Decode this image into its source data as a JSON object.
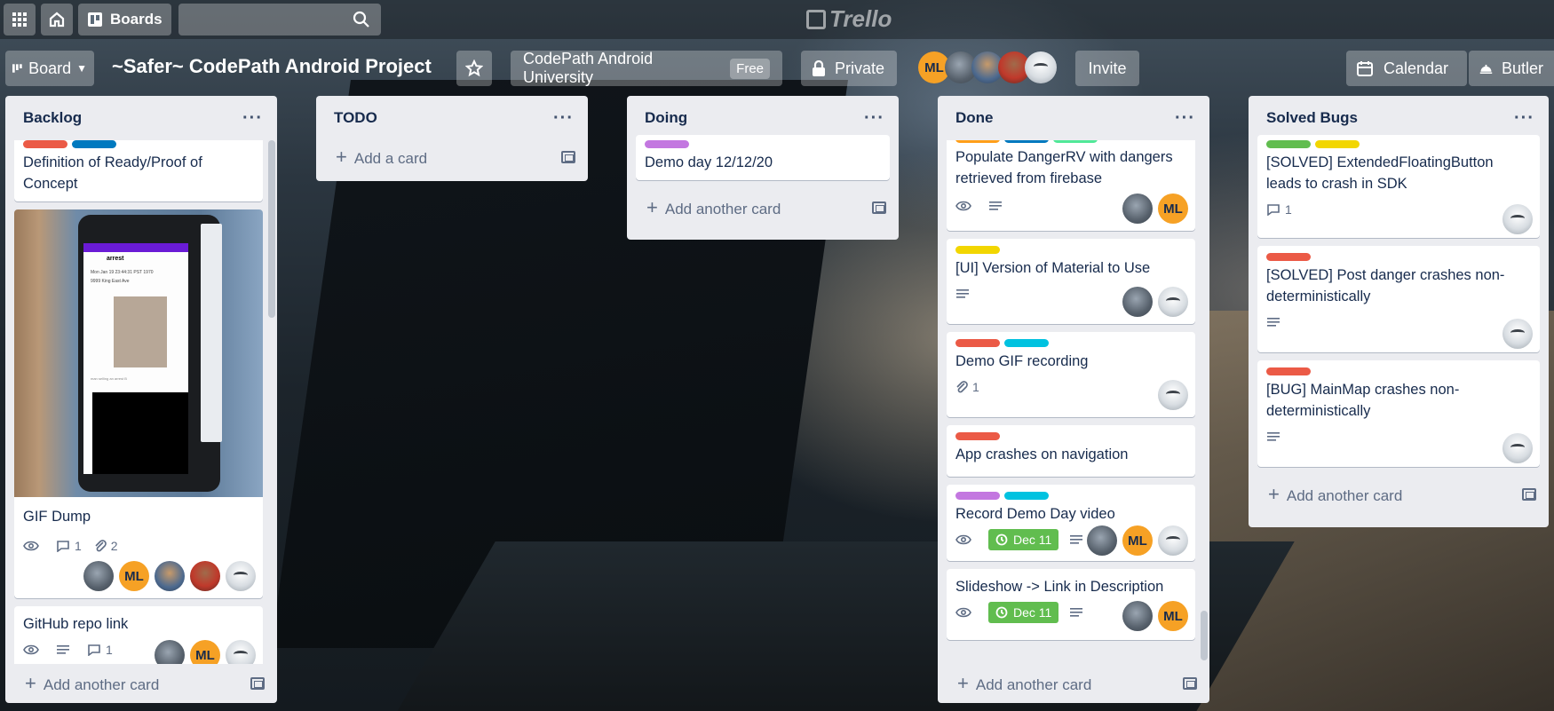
{
  "topbar": {
    "apps_icon": "grid-icon",
    "home_icon": "home-icon",
    "boards_label": "Boards",
    "search_placeholder": "",
    "logo_text": "Trello"
  },
  "board": {
    "switch_label": "Board",
    "title": "~Safer~ CodePath Android Project",
    "workspace": "CodePath Android University",
    "workspace_badge": "Free",
    "visibility": "Private",
    "invite_label": "Invite",
    "calendar_label": "Calendar",
    "butler_label": "Butler",
    "members": [
      "ML",
      "",
      "",
      "",
      ""
    ]
  },
  "lists": [
    {
      "title": "Backlog",
      "add_label": "Add another card",
      "cards": [
        {
          "title": "Definition of Ready/Proof of Concept",
          "labels": [
            "#eb5a46",
            "#0079bf"
          ]
        },
        {
          "title": "GIF Dump",
          "watch": true,
          "comments": "1",
          "attachments": "2",
          "members": [
            "p1",
            "ML",
            "p2",
            "p3",
            "bot"
          ]
        },
        {
          "title": "GitHub repo link",
          "watch": true,
          "description": true,
          "comments": "1",
          "members": [
            "p1",
            "ML",
            "bot"
          ]
        }
      ]
    },
    {
      "title": "TODO",
      "add_label": "Add a card",
      "cards": []
    },
    {
      "title": "Doing",
      "add_label": "Add another card",
      "cards": [
        {
          "title": "Demo day 12/12/20",
          "labels": [
            "#c377e0"
          ]
        }
      ]
    },
    {
      "title": "Done",
      "add_label": "Add another card",
      "cards": [
        {
          "title": "Populate DangerRV with dangers retrieved from firebase",
          "labels": [
            "#ff9f1a",
            "#0079bf",
            "#51e898"
          ]
        },
        {
          "title": "[UI] Version of Material to Use",
          "labels": [
            "#f2d600"
          ]
        },
        {
          "title": "Demo GIF recording",
          "labels": [
            "#eb5a46",
            "#00c2e0"
          ],
          "attachments": "1"
        },
        {
          "title": "App crashes on navigation",
          "labels": [
            "#eb5a46"
          ]
        },
        {
          "title": "Record Demo Day video",
          "labels": [
            "#c377e0",
            "#00c2e0"
          ],
          "due": "Dec 11"
        },
        {
          "title": "Slideshow -> Link in Description",
          "due": "Dec 11"
        }
      ]
    },
    {
      "title": "Solved Bugs",
      "add_label": "Add another card",
      "cards": [
        {
          "title": "[SOLVED] ExtendedFloatingButton leads to crash in SDK",
          "labels": [
            "#61bd4f",
            "#f2d600"
          ],
          "comments": "1"
        },
        {
          "title": "[SOLVED] Post danger crashes non-deterministically",
          "labels": [
            "#eb5a46"
          ]
        },
        {
          "title": "[BUG] MainMap crashes non-deterministically",
          "labels": [
            "#eb5a46"
          ]
        }
      ]
    }
  ],
  "cover_image": {
    "title": "arrest",
    "timestamp": "Mon Jan 19 23:44:31 PST 1970",
    "address": "9999 King East Ave",
    "caption": "man selling an arrest B"
  },
  "colors": {
    "due_green": "#61bd4f",
    "avatar_orange": "#f6a125",
    "list_bg": "#ebecf0"
  }
}
